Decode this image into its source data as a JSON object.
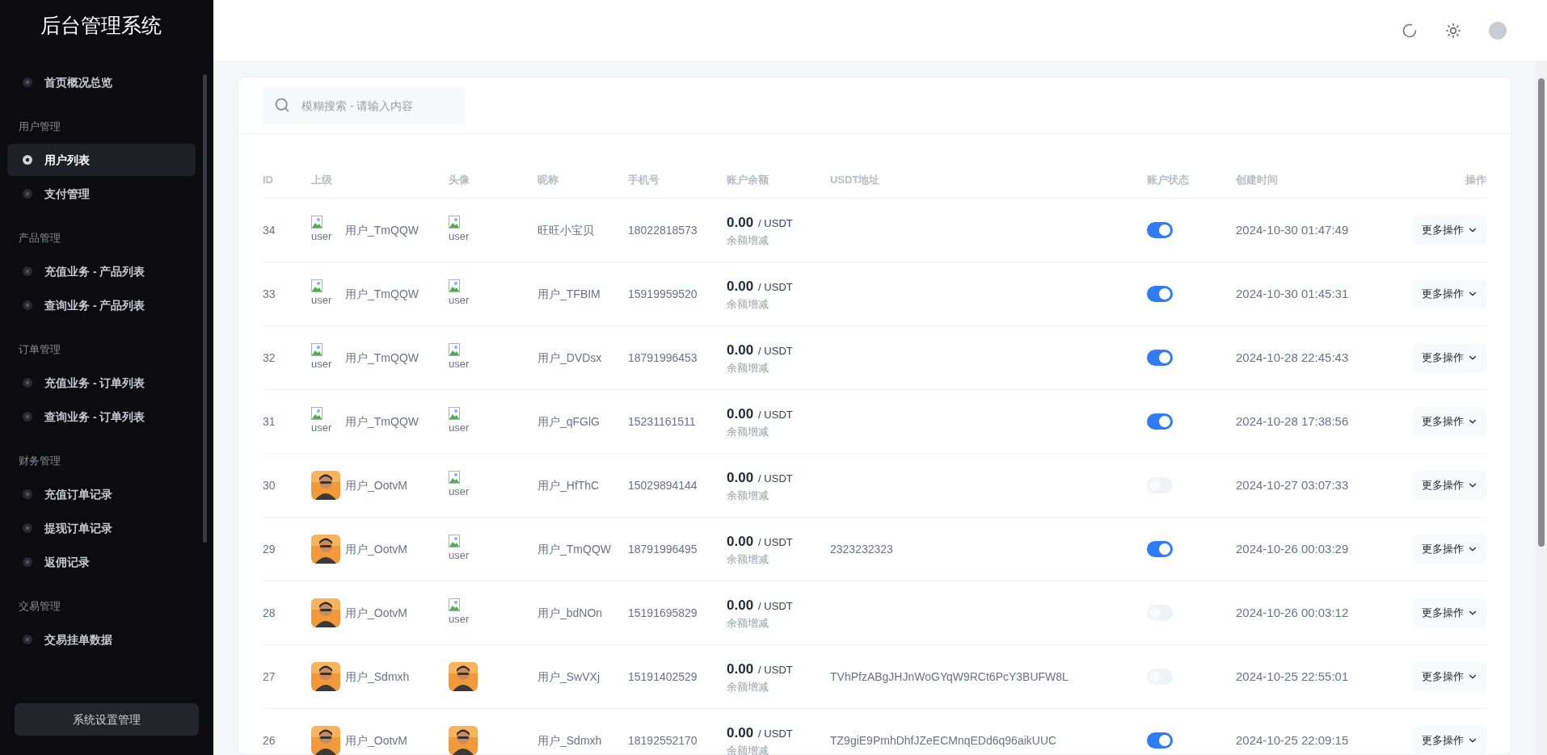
{
  "sidebar": {
    "title": "后台管理系统",
    "sections": [
      {
        "items": [
          {
            "label": "首页概况总览",
            "selected": false
          }
        ]
      },
      {
        "title": "用户管理",
        "items": [
          {
            "label": "用户列表",
            "selected": true
          },
          {
            "label": "支付管理",
            "selected": false
          }
        ]
      },
      {
        "title": "产品管理",
        "items": [
          {
            "label": "充值业务 - 产品列表",
            "selected": false
          },
          {
            "label": "查询业务 - 产品列表",
            "selected": false
          }
        ]
      },
      {
        "title": "订单管理",
        "items": [
          {
            "label": "充值业务 - 订单列表",
            "selected": false
          },
          {
            "label": "查询业务 - 订单列表",
            "selected": false
          }
        ]
      },
      {
        "title": "财务管理",
        "items": [
          {
            "label": "充值订单记录",
            "selected": false
          },
          {
            "label": "提现订单记录",
            "selected": false
          },
          {
            "label": "返佣记录",
            "selected": false
          }
        ]
      },
      {
        "title": "交易管理",
        "items": [
          {
            "label": "交易挂单数据",
            "selected": false
          }
        ]
      }
    ],
    "footer_button": "系统设置管理"
  },
  "search": {
    "placeholder": "模糊搜索 - 请输入内容"
  },
  "table": {
    "columns": [
      "ID",
      "上级",
      "头像",
      "昵称",
      "手机号",
      "账户余额",
      "USDT地址",
      "账户状态",
      "创建时间",
      "操作"
    ],
    "rows": [
      {
        "id": "34",
        "parent": {
          "avatar": {
            "kind": "broken",
            "alt": "user"
          },
          "name": "用户_TmQQW"
        },
        "avatar": {
          "kind": "broken",
          "alt": "user"
        },
        "nickname": "旺旺小宝贝",
        "phone": "18022818573",
        "balance": "0.00",
        "unit": "/ USDT",
        "balance_link": "余额增减",
        "on": true,
        "created": "2024-10-30 01:47:49",
        "action": "更多操作"
      },
      {
        "id": "33",
        "parent": {
          "avatar": {
            "kind": "broken",
            "alt": "user"
          },
          "name": "用户_TmQQW"
        },
        "avatar": {
          "kind": "broken",
          "alt": "user"
        },
        "nickname": "用户_TFBIM",
        "phone": "15919959520",
        "balance": "0.00",
        "unit": "/ USDT",
        "balance_link": "余额增减",
        "on": true,
        "created": "2024-10-30 01:45:31",
        "action": "更多操作"
      },
      {
        "id": "32",
        "parent": {
          "avatar": {
            "kind": "broken",
            "alt": "user"
          },
          "name": "用户_TmQQW"
        },
        "avatar": {
          "kind": "broken",
          "alt": "user"
        },
        "nickname": "用户_DVDsx",
        "phone": "18791996453",
        "balance": "0.00",
        "unit": "/ USDT",
        "balance_link": "余额增减",
        "on": true,
        "created": "2024-10-28 22:45:43",
        "action": "更多操作"
      },
      {
        "id": "31",
        "parent": {
          "avatar": {
            "kind": "broken",
            "alt": "user"
          },
          "name": "用户_TmQQW"
        },
        "avatar": {
          "kind": "broken",
          "alt": "user"
        },
        "nickname": "用户_qFGlG",
        "phone": "15231161511",
        "balance": "0.00",
        "unit": "/ USDT",
        "balance_link": "余额增减",
        "on": true,
        "created": "2024-10-28 17:38:56",
        "action": "更多操作"
      },
      {
        "id": "30",
        "parent": {
          "name": "用户_OotvM"
        },
        "avatar": {
          "kind": "broken",
          "alt": "user"
        },
        "nickname": "用户_HfThC",
        "phone": "15029894144",
        "balance": "0.00",
        "unit": "/ USDT",
        "balance_link": "余额增减",
        "on": false,
        "created": "2024-10-27 03:07:33",
        "action": "更多操作"
      },
      {
        "id": "29",
        "parent": {
          "name": "用户_OotvM"
        },
        "avatar": {
          "kind": "broken",
          "alt": "user"
        },
        "nickname": "用户_TmQQW",
        "phone": "18791996495",
        "balance": "0.00",
        "unit": "/ USDT",
        "balance_link": "余额增减",
        "usdt": "2323232323",
        "on": true,
        "created": "2024-10-26 00:03:29",
        "action": "更多操作"
      },
      {
        "id": "28",
        "parent": {
          "name": "用户_OotvM"
        },
        "avatar": {
          "kind": "broken",
          "alt": "user"
        },
        "nickname": "用户_bdNOn",
        "phone": "15191695829",
        "balance": "0.00",
        "unit": "/ USDT",
        "balance_link": "余额增减",
        "on": false,
        "created": "2024-10-26 00:03:12",
        "action": "更多操作"
      },
      {
        "id": "27",
        "parent": {
          "name": "用户_Sdmxh"
        },
        "nickname": "用户_SwVXj",
        "phone": "15191402529",
        "balance": "0.00",
        "unit": "/ USDT",
        "balance_link": "余额增减",
        "usdt": "TVhPfzABgJHJnWoGYqW9RCt6PcY3BUFW8L",
        "on": false,
        "created": "2024-10-25 22:55:01",
        "action": "更多操作"
      },
      {
        "id": "26",
        "parent": {
          "name": "用户_OotvM"
        },
        "nickname": "用户_Sdmxh",
        "phone": "18192552170",
        "balance": "0.00",
        "unit": "/ USDT",
        "balance_link": "余额增减",
        "usdt": "TZ9giE9PmhDhfJZeECMnqEDd6q96aikUUC",
        "on": true,
        "created": "2024-10-25 22:09:15",
        "action": "更多操作"
      }
    ]
  }
}
